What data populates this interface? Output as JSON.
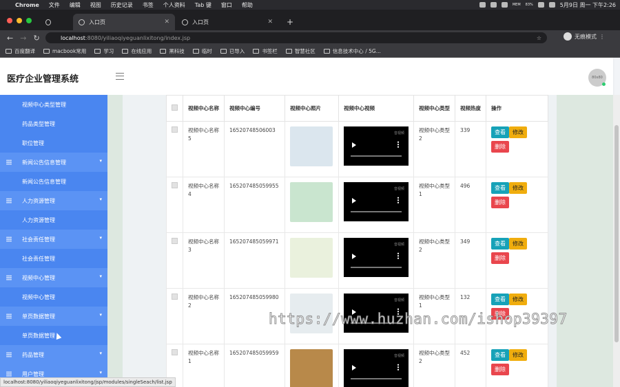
{
  "macos_menu": {
    "app": "Chrome",
    "items": [
      "文件",
      "编辑",
      "视图",
      "历史记录",
      "书签",
      "个人资料",
      "Tab 键",
      "窗口",
      "帮助"
    ],
    "mem_label": "MEM",
    "mem_value": "83%",
    "datetime": "5月9日 周一 下午2:26"
  },
  "browser": {
    "tabs": [
      {
        "label": ""
      },
      {
        "label": "入口页"
      },
      {
        "label": "入口页"
      }
    ],
    "new_tab": "+",
    "url_host": "localhost",
    "url_path": ":8080/yiliaoqiyeguanlixitong/index.jsp",
    "incognito_label": "无痕模式",
    "bookmarks": [
      "百度翻译",
      "macbook常用",
      "学习",
      "在线应用",
      "黑科技",
      "临时",
      "已导入",
      "书签栏",
      "智慧社区",
      "信息技术中心 / 5G..."
    ]
  },
  "header": {
    "title": "医疗企业管理系统",
    "avatar_text": "80x80"
  },
  "sidebar": {
    "items": [
      {
        "label": "视频中心类型管理",
        "group": false
      },
      {
        "label": "药品类型管理",
        "group": false
      },
      {
        "label": "职位管理",
        "group": false
      },
      {
        "label": "新闻公告信息管理",
        "group": true
      },
      {
        "label": "新闻公告信息管理",
        "group": false
      },
      {
        "label": "人力资源管理",
        "group": true
      },
      {
        "label": "人力资源管理",
        "group": false
      },
      {
        "label": "社会责任管理",
        "group": true
      },
      {
        "label": "社会责任管理",
        "group": false
      },
      {
        "label": "视频中心管理",
        "group": true
      },
      {
        "label": "视频中心管理",
        "group": false
      },
      {
        "label": "单页数据管理",
        "group": true
      },
      {
        "label": "单页数据管理",
        "group": false
      },
      {
        "label": "药品管理",
        "group": true
      },
      {
        "label": "用户管理",
        "group": true
      }
    ]
  },
  "table": {
    "headers": [
      "",
      "视频中心名称",
      "视频中心编号",
      "视频中心照片",
      "视频中心视频",
      "视频中心类型",
      "视频热度",
      "操作"
    ],
    "rows": [
      {
        "name": "视频中心名称5",
        "code": "16520748506003",
        "type": "视频中心类型2",
        "heat": "339",
        "photo_color": "#dbe6ee"
      },
      {
        "name": "视频中心名称4",
        "code": "165207485059955",
        "type": "视频中心类型1",
        "heat": "496",
        "photo_color": "#c9e5cf"
      },
      {
        "name": "视频中心名称3",
        "code": "165207485059971",
        "type": "视频中心类型2",
        "heat": "349",
        "photo_color": "#eaf1dd"
      },
      {
        "name": "视频中心名称2",
        "code": "165207485059980",
        "type": "视频中心类型1",
        "heat": "132",
        "photo_color": "#e6ecef"
      },
      {
        "name": "视频中心名称1",
        "code": "165207485059959",
        "type": "视频中心类型2",
        "heat": "452",
        "photo_color": "#b8894a"
      }
    ],
    "actions": {
      "view": "查看",
      "edit": "修改",
      "delete": "删除"
    },
    "video_tag": "音视频"
  },
  "status_url": "localhost:8080/yiliaoqiyeguanlixitong/jsp/modules/singleSeach/list.jsp",
  "watermark": "https://www.huzhan.com/ishop39397",
  "colors": {
    "sidebar": "#4a86f0",
    "view": "#17a2b8",
    "edit": "#f0ad0e",
    "delete": "#e9464d"
  }
}
